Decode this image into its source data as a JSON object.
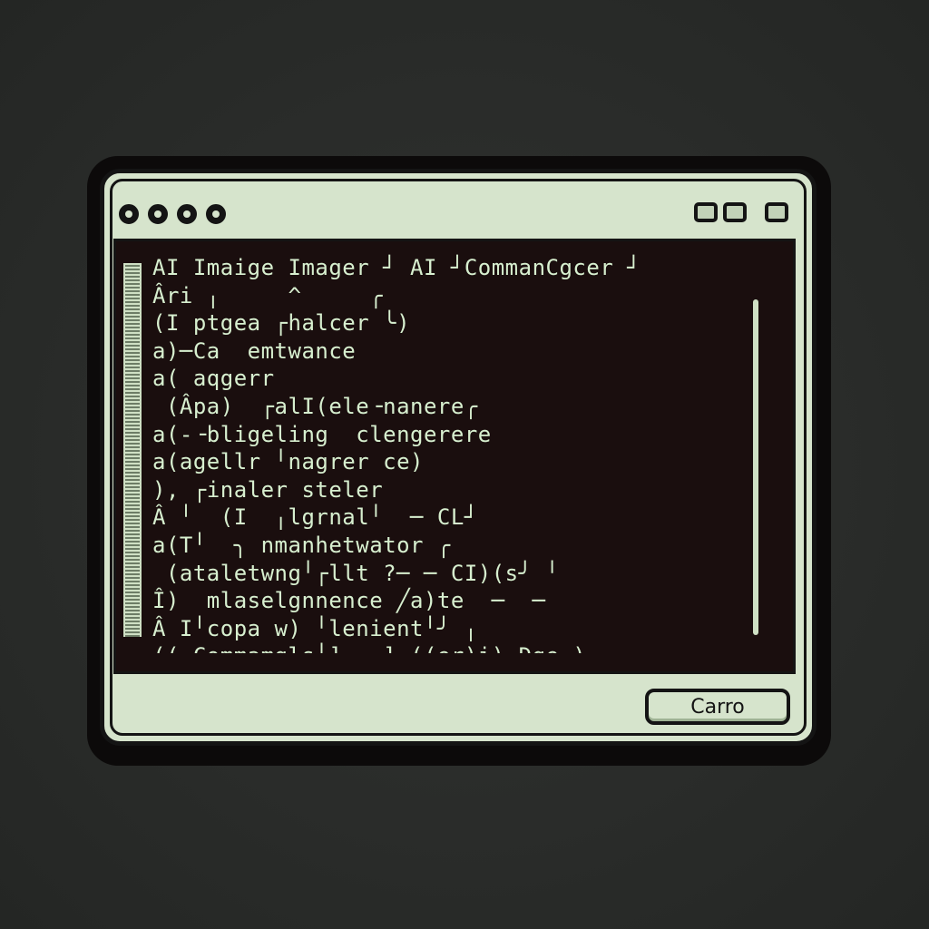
{
  "colors": {
    "background": "#2a2c2a",
    "window_frame": "#d6e4cc",
    "terminal_bg": "#1a0e0e",
    "terminal_text": "#d7efcf",
    "outline": "#141414"
  },
  "titlebar": {
    "dots_icon": "circle-icon",
    "buttons_icon": "window-control-icon"
  },
  "terminal": {
    "lines": [
      "AI Imaige Imager ┘ AI ┘CommanCgcer ┘",
      "Âri ╷     ^     ╭",
      "(I ptgea ┌halcer ╰)",
      "a)─Ca  emtwance",
      "a( aqgerr",
      " (Âpa)  ┌alI(ele╶nanere╭",
      "a(-╶bligeling  clengerere",
      "a(agellr ╵nagrer ce)",
      "), ┌inaler steler",
      "Â ╵  (I  ╷lgrnal╵  ─ CL┘",
      "a(T╵  ╮ nmanhetwator ╭",
      " (ataletwng╵┌llt ?─ ─ CI)(s╯ ╵",
      "Î)  mlaselgnnence ╱a)te  ─  ─",
      "Â I╵copa w) ╵lenient╵╯ ╷",
      "((╭Commamgls╵]  ─]-((er)i) Dge )▾"
    ]
  },
  "footer": {
    "cancel_label": "Carro"
  }
}
